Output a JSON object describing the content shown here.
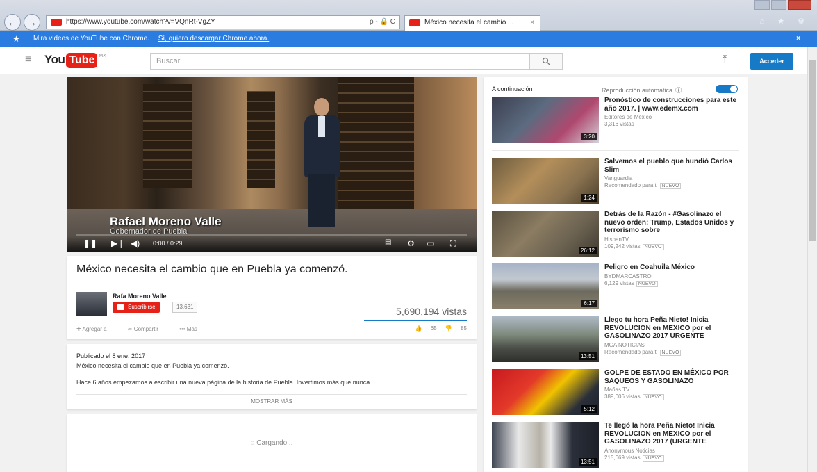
{
  "browser": {
    "url": "https://www.youtube.com/watch?v=VQnRt-VgZY",
    "tab_title": "México necesita el cambio ...",
    "addr_controls": "ρ - 🔒 C",
    "tab_close": "×",
    "back": "←",
    "forward": "→",
    "right_icons": "⌂ ★ ⚙"
  },
  "promo": {
    "text": "Mira videos de YouTube con Chrome.",
    "link": "Sí, quiero descargar Chrome ahora.",
    "close": "×",
    "star": "★"
  },
  "header": {
    "logo_you": "You",
    "logo_tube": "Tube",
    "logo_country": "MX",
    "search_placeholder": "Buscar",
    "signin": "Acceder"
  },
  "player": {
    "overlay_name": "Rafael Moreno Valle",
    "overlay_sub": "Gobernador de Puebla",
    "time": "0:00 / 0:29",
    "progress": 0.0
  },
  "video": {
    "title": "México necesita el cambio que en Puebla ya comenzó.",
    "channel": "Rafa Moreno Valle",
    "subscribe": "Suscribirse",
    "sub_count": "13,631",
    "views": "5,690,194 vistas",
    "add_to": "Agregar a",
    "share": "Compartir",
    "more": "••• Más",
    "likes": "65",
    "dislikes": "85"
  },
  "description": {
    "published": "Publicado el 8 ene. 2017",
    "line1": "México necesita el cambio que en Puebla ya comenzó.",
    "line2": "Hace 6 años empezamos a escribir una nueva página de la historia de Puebla. Invertimos más que nunca",
    "show_more": "MOSTRAR MÁS"
  },
  "loading": {
    "text": "Cargando..."
  },
  "sidebar": {
    "up_next": "A continuación",
    "autoplay": "Reproducción automática",
    "items": [
      {
        "title": "Pronóstico de construcciones para este año 2017. | www.edemx.com",
        "channel": "Editores de México",
        "views": "3,316 vistas",
        "badge": "",
        "duration": "3:20"
      },
      {
        "title": "Salvemos el pueblo que hundió Carlos Slim",
        "channel": "Vanguardia",
        "views": "Recomendado para ti",
        "badge": "NUEVO",
        "duration": "1:24"
      },
      {
        "title": "Detrás de la Razón - #Gasolinazo el nuevo orden: Trump, Estados Unidos y terrorismo sobre",
        "channel": "HispanTV",
        "views": "109,242 vistas",
        "badge": "NUEVO",
        "duration": "26:12"
      },
      {
        "title": "Peligro en Coahuila México",
        "channel": "BYDMARCASTRO",
        "views": "6,129 vistas",
        "badge": "NUEVO",
        "duration": "6:17"
      },
      {
        "title": "Llego tu hora Peña Nieto! Inicia REVOLUCION en MEXICO por el GASOLINAZO 2017 URGENTE",
        "channel": "MGA NOTICIAS",
        "views": "Recomendado para ti",
        "badge": "NUEVO",
        "duration": "13:51"
      },
      {
        "title": "GOLPE DE ESTADO EN MÉXICO POR SAQUEOS Y GASOLINAZO",
        "channel": "Mañas TV",
        "views": "389,006 vistas",
        "badge": "NUEVO",
        "duration": "5:12"
      },
      {
        "title": "Te llegó la hora Peña Nieto! Inicia REVOLUCION en MEXICO por el GASOLINAZO 2017 (URGENTE",
        "channel": "Anonymous Noticias",
        "views": "215,669 vistas",
        "badge": "NUEVO",
        "duration": "13:51"
      }
    ]
  }
}
